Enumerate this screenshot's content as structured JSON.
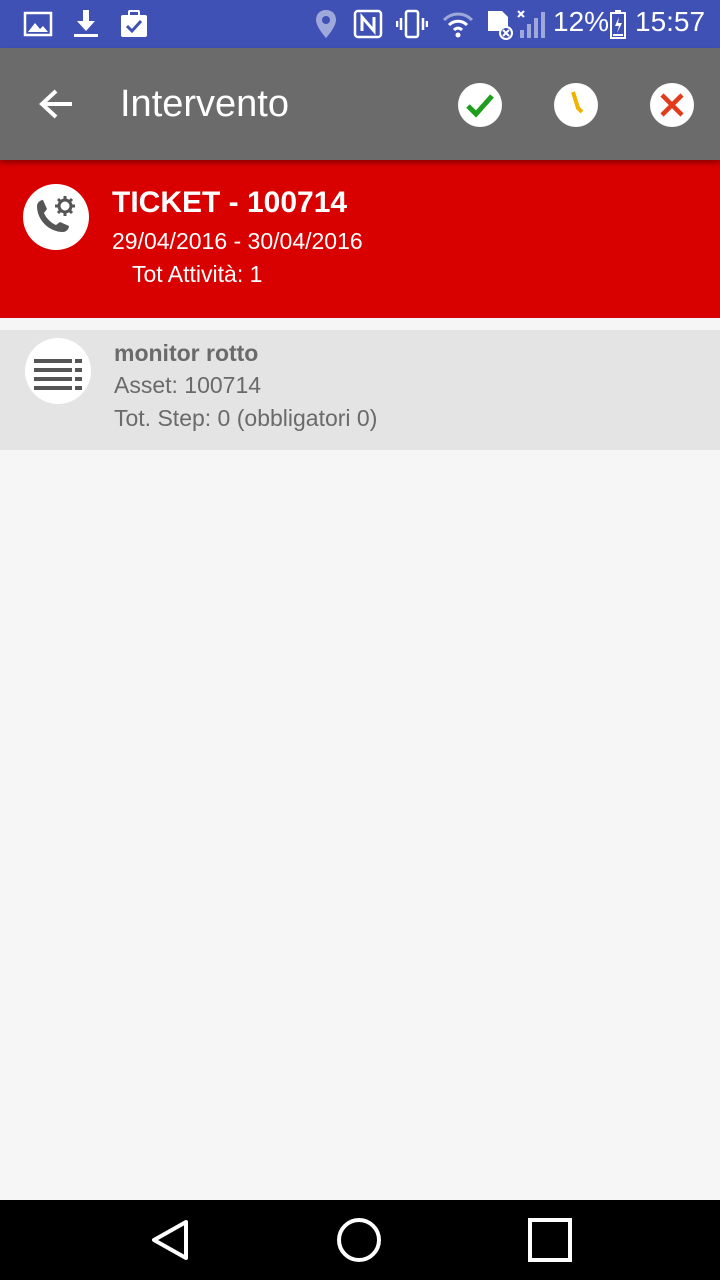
{
  "status_bar": {
    "battery": "12%",
    "time": "15:57",
    "icons": [
      "gallery-icon",
      "download-icon",
      "clipboard-check-icon",
      "location-icon",
      "nfc-icon",
      "vibrate-icon",
      "wifi-icon",
      "sd-card-icon",
      "signal-icon",
      "battery-icon"
    ]
  },
  "toolbar": {
    "title": "Intervento",
    "actions": [
      "check-icon",
      "clock-icon",
      "close-icon"
    ],
    "colors": {
      "background": "#6b6b6b",
      "check": "#1f9d1f",
      "clock": "#f0b400",
      "close": "#e23b1b"
    }
  },
  "ticket": {
    "title": "TICKET - 100714",
    "dates": "29/04/2016 - 30/04/2016",
    "activity_count": "Tot Attività: 1",
    "color": "#d90000"
  },
  "activities": [
    {
      "title": "monitor rotto",
      "asset": "Asset: 100714",
      "steps": "Tot. Step: 0 (obbligatori 0)"
    }
  ],
  "nav_bar": {
    "buttons": [
      "back-icon",
      "home-icon",
      "recents-icon"
    ]
  }
}
